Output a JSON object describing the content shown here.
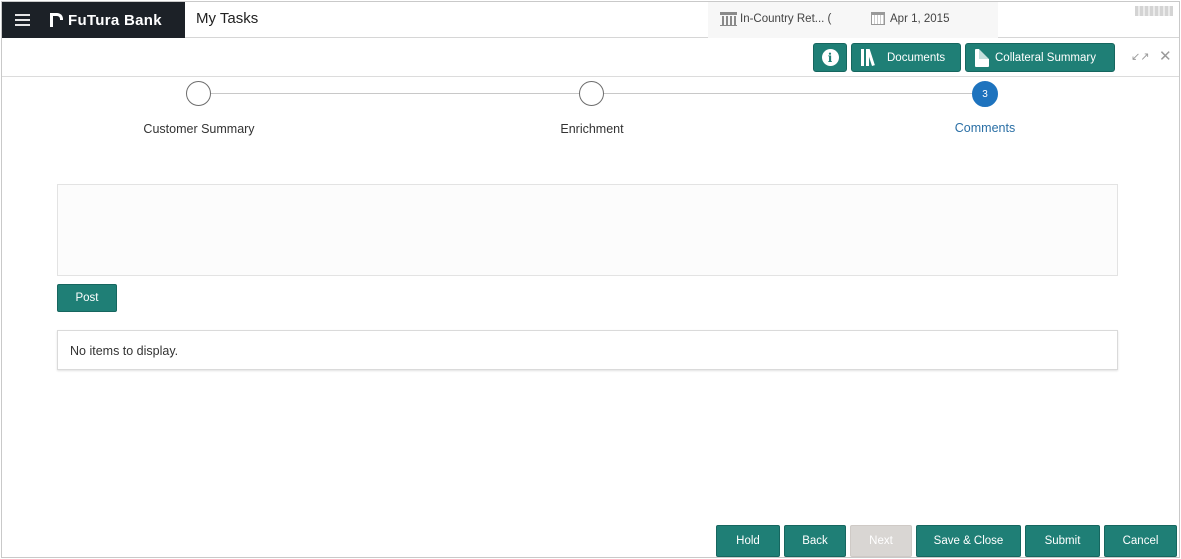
{
  "header": {
    "brand": "FuTura Bank",
    "page_title": "My Tasks",
    "branch": "In-Country Ret... (",
    "date": "Apr 1, 2015"
  },
  "toolbar": {
    "documents_label": "Documents",
    "collateral_label": "Collateral Summary"
  },
  "stepper": {
    "steps": [
      {
        "label": "Customer Summary",
        "number": "",
        "state": "complete"
      },
      {
        "label": "Enrichment",
        "number": "",
        "state": "complete"
      },
      {
        "label": "Comments",
        "number": "3",
        "state": "active"
      }
    ]
  },
  "comments": {
    "post_label": "Post",
    "empty_message": "No items to display."
  },
  "footer": {
    "hold": "Hold",
    "back": "Back",
    "next": "Next",
    "save_close": "Save & Close",
    "submit": "Submit",
    "cancel": "Cancel"
  },
  "colors": {
    "primary": "#1f7f76",
    "active_step": "#1e73be",
    "brand_bg": "#1c2127"
  }
}
